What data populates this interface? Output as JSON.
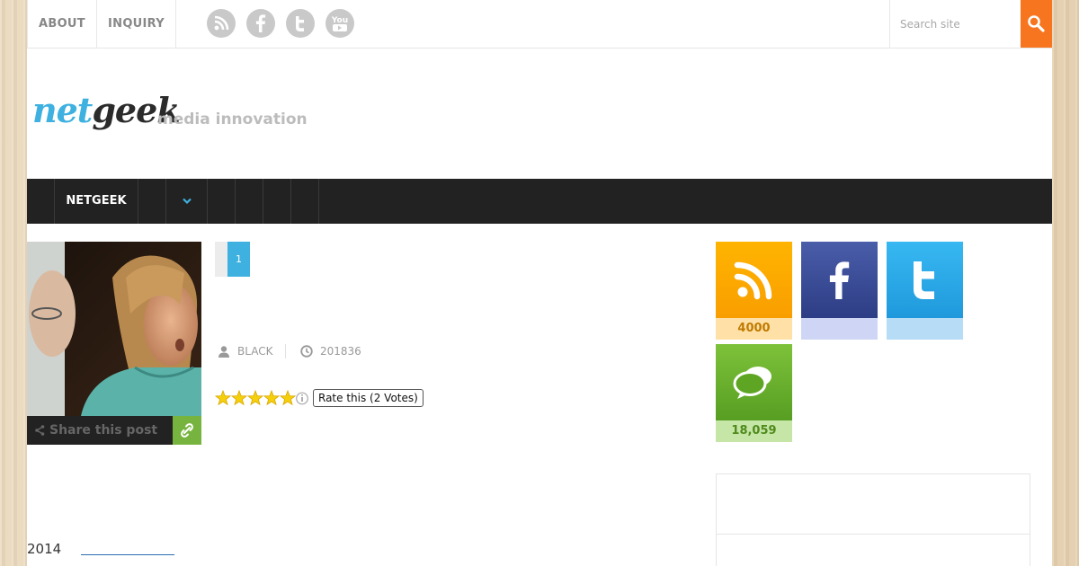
{
  "topnav": {
    "links": [
      "ABOUT",
      "INQUIRY"
    ],
    "social_icons": [
      "rss-icon",
      "facebook-icon",
      "twitter-icon",
      "youtube-icon"
    ],
    "youtube_text": "You"
  },
  "search": {
    "placeholder": "Search site"
  },
  "logo": {
    "net": "net",
    "geek": "geek",
    "tagline": "media innovation"
  },
  "mainnav": {
    "items": [
      "NETGEEK"
    ]
  },
  "post": {
    "share_label": "Share this post",
    "pager_current": "1",
    "author": "BLACK",
    "date": "201836",
    "rating_tooltip": "Rate this (2 Votes)",
    "stars_filled": 5,
    "stars_total": 5
  },
  "footer_snippet": {
    "year": "2014"
  },
  "sidebar": {
    "rss_count": "4000",
    "comments_count": "18,059"
  },
  "colors": {
    "accent_blue": "#3fb1e0",
    "search_orange": "#f7751f",
    "nav_dark": "#222222",
    "rss_orange": "#f9a602",
    "facebook_navy": "#3b4d9a",
    "twitter_blue": "#2aa9e8",
    "comments_green": "#6aaf2c",
    "share_green": "#77b43f"
  }
}
